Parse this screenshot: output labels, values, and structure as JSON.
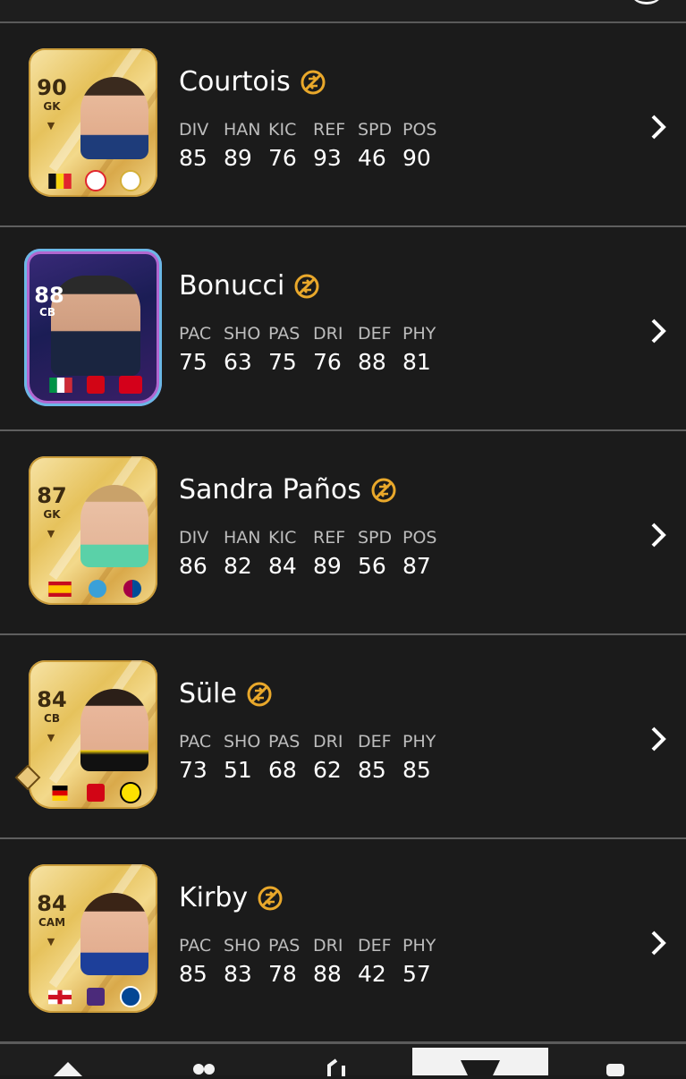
{
  "players": [
    {
      "name": "Courtois",
      "rating": "90",
      "position": "GK",
      "card_style": "gold",
      "stat_labels": [
        "DIV",
        "HAN",
        "KIC",
        "REF",
        "SPD",
        "POS"
      ],
      "stat_values": [
        "85",
        "89",
        "76",
        "93",
        "46",
        "90"
      ]
    },
    {
      "name": "Bonucci",
      "rating": "88",
      "position": "CB",
      "card_style": "special",
      "stat_labels": [
        "PAC",
        "SHO",
        "PAS",
        "DRI",
        "DEF",
        "PHY"
      ],
      "stat_values": [
        "75",
        "63",
        "75",
        "76",
        "88",
        "81"
      ]
    },
    {
      "name": "Sandra Paños",
      "rating": "87",
      "position": "GK",
      "card_style": "gold",
      "stat_labels": [
        "DIV",
        "HAN",
        "KIC",
        "REF",
        "SPD",
        "POS"
      ],
      "stat_values": [
        "86",
        "82",
        "84",
        "89",
        "56",
        "87"
      ]
    },
    {
      "name": "Süle",
      "rating": "84",
      "position": "CB",
      "card_style": "gold",
      "stat_labels": [
        "PAC",
        "SHO",
        "PAS",
        "DRI",
        "DEF",
        "PHY"
      ],
      "stat_values": [
        "73",
        "51",
        "68",
        "62",
        "85",
        "85"
      ]
    },
    {
      "name": "Kirby",
      "rating": "84",
      "position": "CAM",
      "card_style": "gold",
      "stat_labels": [
        "PAC",
        "SHO",
        "PAS",
        "DRI",
        "DEF",
        "PHY"
      ],
      "stat_values": [
        "85",
        "83",
        "78",
        "88",
        "42",
        "57"
      ]
    }
  ],
  "icons": {
    "untradeable": "untradeable-icon",
    "chevron": "chevron-right-icon",
    "nav": [
      "home-icon",
      "squad-icon",
      "transfers-icon",
      "store-icon",
      "club-icon"
    ]
  },
  "colors": {
    "background": "#1b1b1b",
    "divider": "#5f5f5f",
    "accent_gold": "#e9a82b",
    "stat_label": "#bdbdbd"
  }
}
